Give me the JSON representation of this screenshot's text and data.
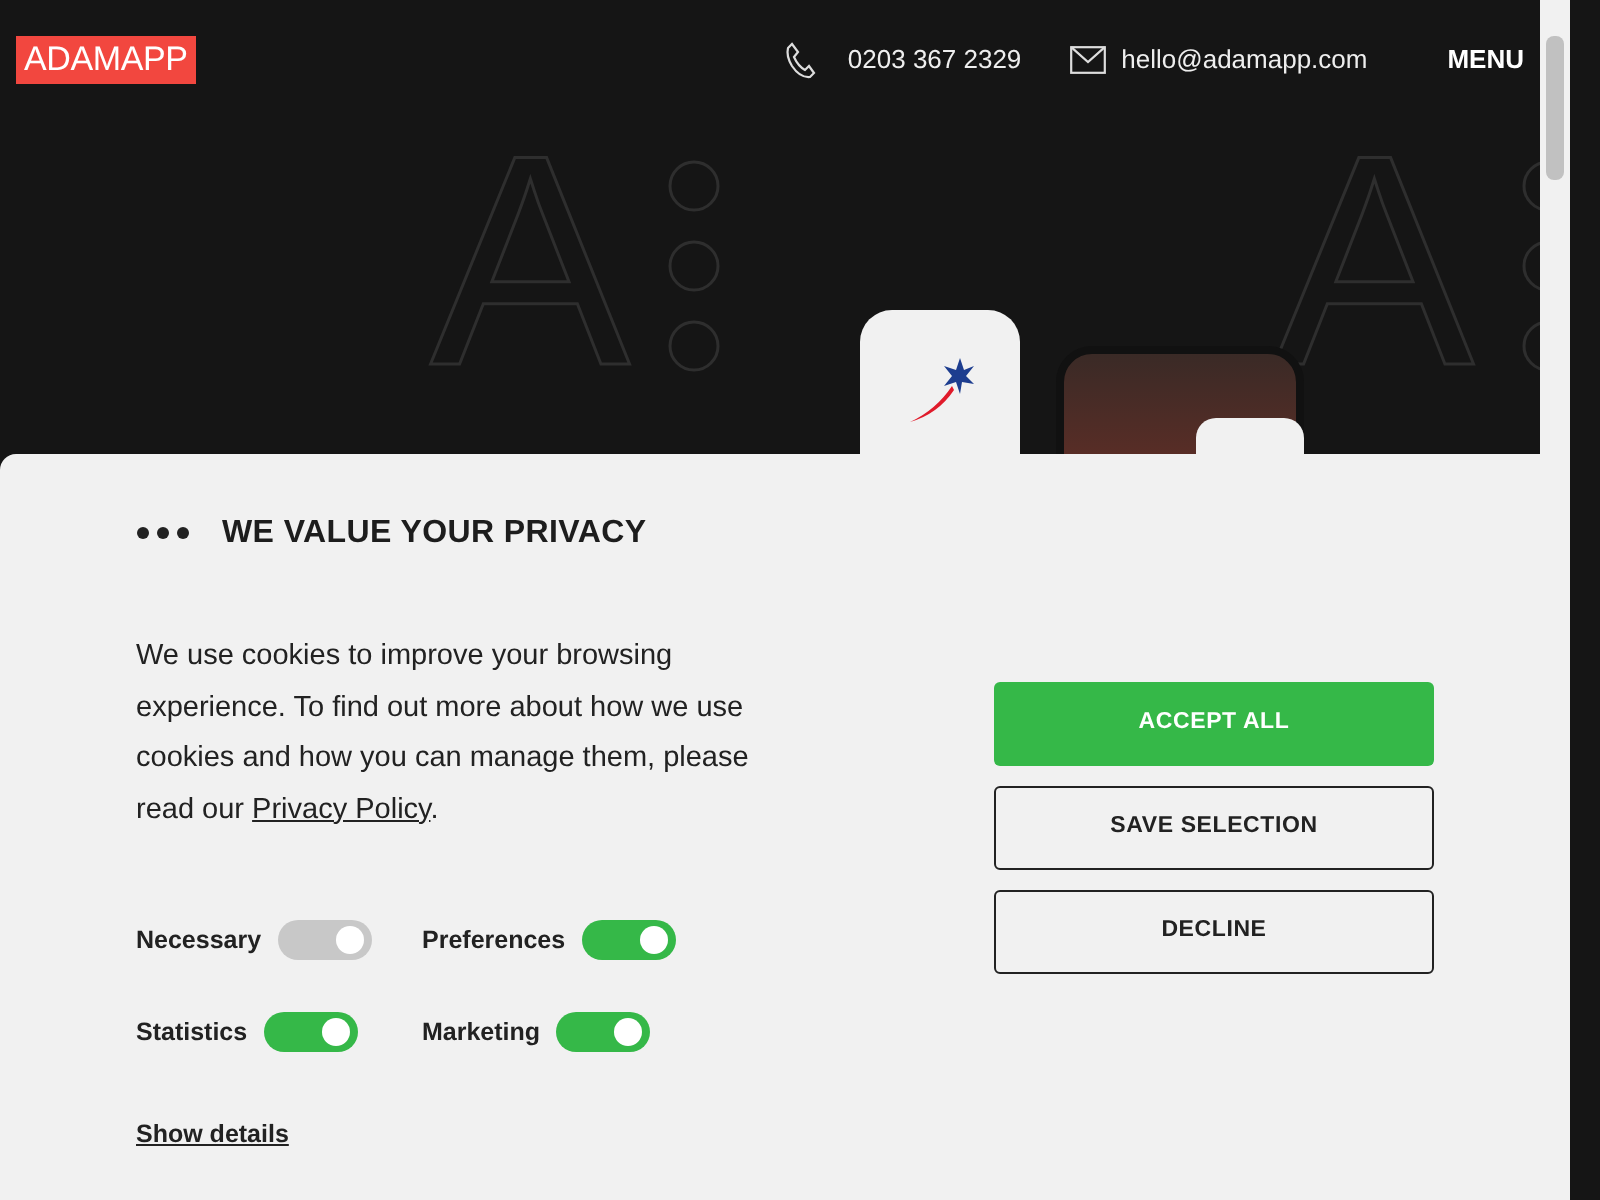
{
  "header": {
    "logo": "ADAMAPP",
    "phone": "0203 367 2329",
    "email": "hello@adamapp.com",
    "menu": "MENU"
  },
  "hero": {
    "decor_letters": [
      "A",
      "A"
    ]
  },
  "consent": {
    "title": "WE VALUE YOUR PRIVACY",
    "text": "We use cookies to improve your browsing experience. To find out more about how we use cookies and how you can manage them, please read our ",
    "link": "Privacy Policy",
    "text_end": ".",
    "toggles": [
      {
        "label": "Necessary",
        "checked": true,
        "disabled": true
      },
      {
        "label": "Preferences",
        "checked": true,
        "disabled": false
      },
      {
        "label": "Statistics",
        "checked": true,
        "disabled": false
      },
      {
        "label": "Marketing",
        "checked": true,
        "disabled": false
      }
    ],
    "details": "Show details",
    "buttons": [
      {
        "label": "ACCEPT ALL",
        "kind": "primary"
      },
      {
        "label": "SAVE SELECTION",
        "kind": "outline"
      },
      {
        "label": "DECLINE",
        "kind": "outline"
      }
    ]
  }
}
